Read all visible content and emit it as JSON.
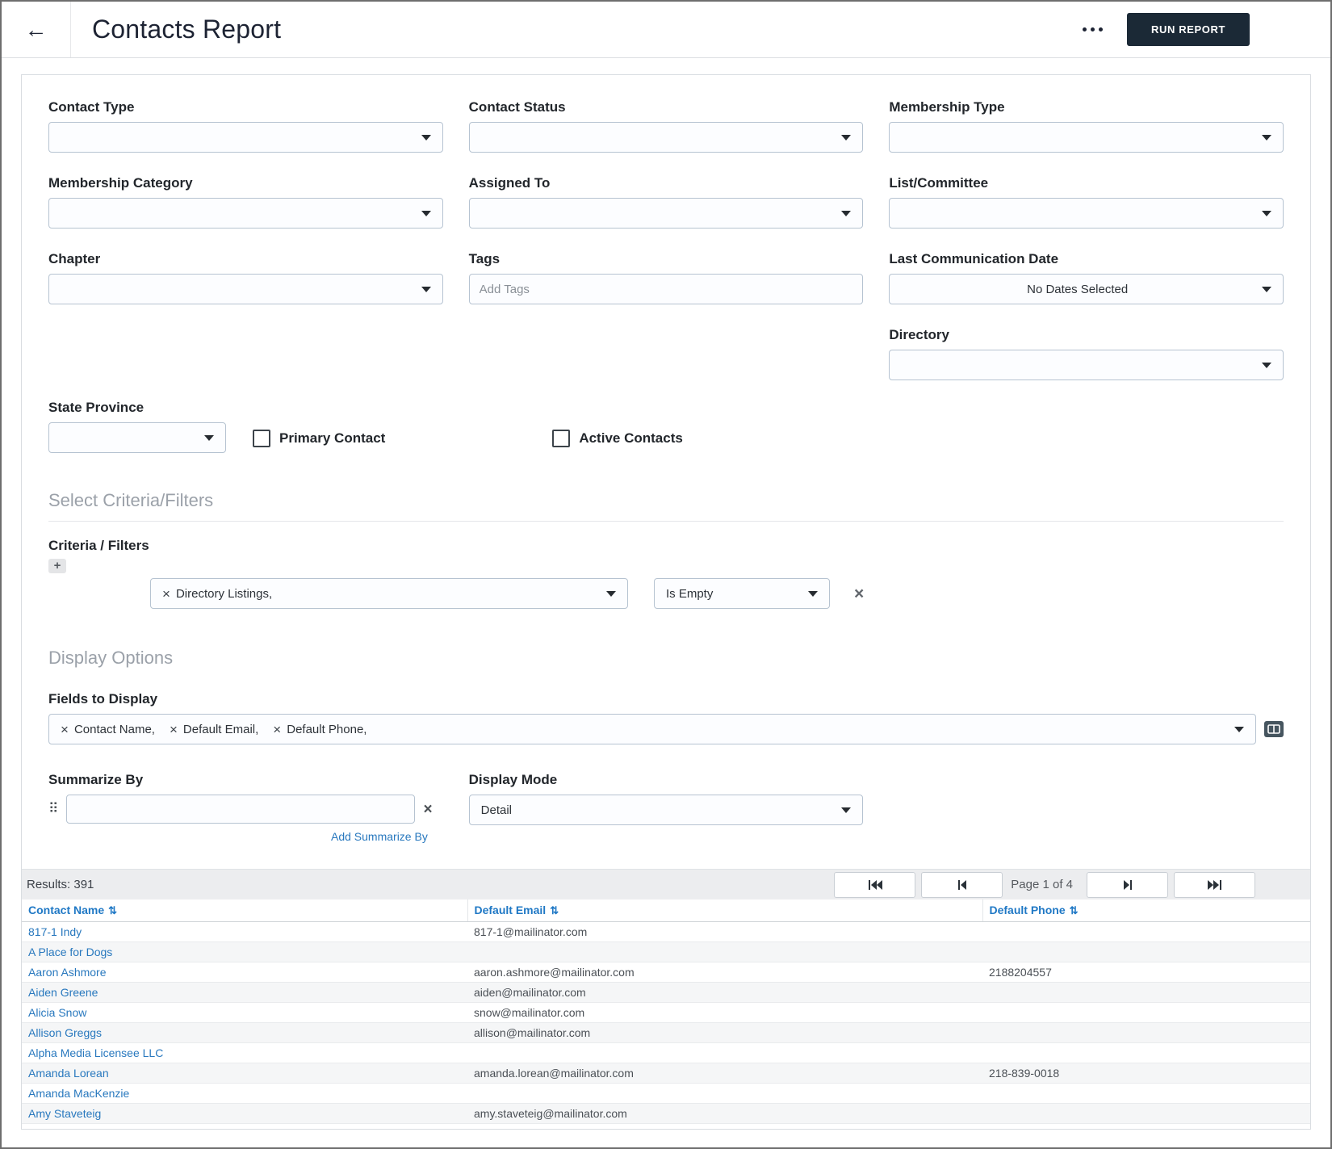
{
  "header": {
    "title": "Contacts Report",
    "run_report_label": "RUN REPORT"
  },
  "filters": {
    "contact_type": {
      "label": "Contact Type",
      "value": ""
    },
    "contact_status": {
      "label": "Contact Status",
      "value": ""
    },
    "membership_type": {
      "label": "Membership Type",
      "value": ""
    },
    "membership_category": {
      "label": "Membership Category",
      "value": ""
    },
    "assigned_to": {
      "label": "Assigned To",
      "value": ""
    },
    "list_committee": {
      "label": "List/Committee",
      "value": ""
    },
    "chapter": {
      "label": "Chapter",
      "value": ""
    },
    "tags": {
      "label": "Tags",
      "placeholder": "Add Tags",
      "value": ""
    },
    "last_communication_date": {
      "label": "Last Communication Date",
      "value": "No Dates Selected"
    },
    "directory": {
      "label": "Directory",
      "value": ""
    },
    "state_province": {
      "label": "State Province",
      "value": ""
    },
    "primary_contact": {
      "label": "Primary Contact",
      "checked": false
    },
    "active_contacts": {
      "label": "Active Contacts",
      "checked": false
    }
  },
  "criteria_section": {
    "heading": "Select Criteria/Filters",
    "label": "Criteria / Filters",
    "add_label": "+",
    "criteria_chip": "Directory Listings,",
    "operator_value": "Is Empty"
  },
  "display_options": {
    "heading": "Display Options",
    "fields_label": "Fields to Display",
    "fields": [
      "Contact Name,",
      "Default Email,",
      "Default Phone,"
    ],
    "summarize_label": "Summarize By",
    "summarize_value": "",
    "add_summarize_label": "Add Summarize By",
    "display_mode_label": "Display Mode",
    "display_mode_value": "Detail"
  },
  "results": {
    "count_label": "Results: 391",
    "page_label": "Page 1 of 4",
    "columns": [
      "Contact Name",
      "Default Email",
      "Default Phone"
    ],
    "rows": [
      {
        "name": "817-1 Indy",
        "email": "817-1@mailinator.com",
        "phone": ""
      },
      {
        "name": "A Place for Dogs",
        "email": "",
        "phone": ""
      },
      {
        "name": "Aaron Ashmore",
        "email": "aaron.ashmore@mailinator.com",
        "phone": "2188204557"
      },
      {
        "name": "Aiden Greene",
        "email": "aiden@mailinator.com",
        "phone": ""
      },
      {
        "name": "Alicia Snow",
        "email": "snow@mailinator.com",
        "phone": ""
      },
      {
        "name": "Allison Greggs",
        "email": "allison@mailinator.com",
        "phone": ""
      },
      {
        "name": "Alpha Media Licensee LLC",
        "email": "",
        "phone": ""
      },
      {
        "name": "Amanda Lorean",
        "email": "amanda.lorean@mailinator.com",
        "phone": "218-839-0018"
      },
      {
        "name": "Amanda MacKenzie",
        "email": "",
        "phone": ""
      },
      {
        "name": "Amy Staveteig",
        "email": "amy.staveteig@mailinator.com",
        "phone": ""
      }
    ]
  },
  "colors": {
    "accent_link": "#2878be",
    "run_button": "#1b2936",
    "table_header_text": "#1f78c5",
    "section_heading": "#9ba1a9"
  }
}
